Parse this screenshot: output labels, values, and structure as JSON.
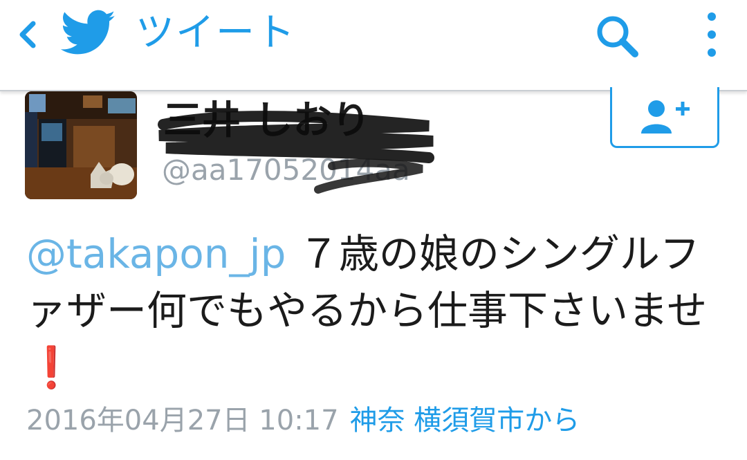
{
  "toolbar": {
    "title": "ツイート",
    "back_icon": "chevron-left-icon",
    "logo_icon": "twitter-bird-icon",
    "search_icon": "search-icon",
    "menu_icon": "overflow-menu-icon"
  },
  "tweet": {
    "display_name": "三井 しおり",
    "handle": "@aa17052014aa",
    "mention": "@takapon_jp",
    "text": " ７歳の娘のシングルファザー何でもやるから仕事下さいませ",
    "emoji": "❗",
    "timestamp": "2016年04月27日 10:17",
    "location": "神奈 横須賀市から",
    "follow_icon": "add-user-icon"
  },
  "colors": {
    "accent": "#1f9ce8",
    "mention": "#6ab5e6",
    "muted": "#9aa3ab",
    "text": "#1b1b1b",
    "emoji_red": "#e0001b"
  }
}
